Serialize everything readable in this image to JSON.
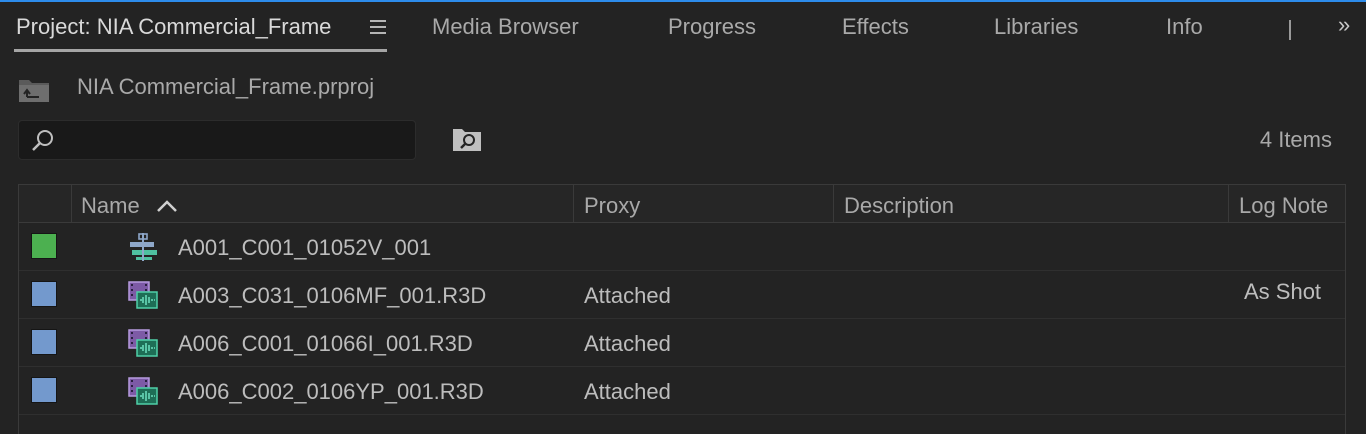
{
  "window": {
    "accent": "#2d8ceb"
  },
  "tabs": [
    {
      "label": "Project: NIA Commercial_Frame",
      "active": true
    },
    {
      "label": "Media Browser"
    },
    {
      "label": "Progress"
    },
    {
      "label": "Effects"
    },
    {
      "label": "Libraries"
    },
    {
      "label": "Info"
    }
  ],
  "tab_icons": {
    "menu": "hamburger-menu-icon",
    "overflow": "double-chevron-right-icon",
    "overflow_glyph": "»"
  },
  "project": {
    "file": "NIA Commercial_Frame.prproj",
    "bin_icon": "bin-up-icon"
  },
  "search": {
    "value": "",
    "placeholder": "",
    "icon": "magnifier-icon",
    "find_icon": "find-in-bin-icon"
  },
  "item_count": "4 Items",
  "table": {
    "columns": [
      "Name",
      "Proxy",
      "Description",
      "Log Note"
    ],
    "sort": {
      "column": "Name",
      "direction": "ascending",
      "icon": "chevron-up-icon"
    },
    "rows": [
      {
        "label_color": "#4cb050",
        "icon": "sequence-icon",
        "name": "A001_C001_01052V_001",
        "proxy": "",
        "description": "",
        "log_note": ""
      },
      {
        "label_color": "#7399cd",
        "icon": "video-audio-clip-icon",
        "name": "A003_C031_0106MF_001.R3D",
        "proxy": "Attached",
        "description": "",
        "log_note": "As Shot"
      },
      {
        "label_color": "#7399cd",
        "icon": "video-audio-clip-icon",
        "name": "A006_C001_01066I_001.R3D",
        "proxy": "Attached",
        "description": "",
        "log_note": ""
      },
      {
        "label_color": "#7399cd",
        "icon": "video-audio-clip-icon",
        "name": "A006_C002_0106YP_001.R3D",
        "proxy": "Attached",
        "description": "",
        "log_note": ""
      }
    ]
  }
}
